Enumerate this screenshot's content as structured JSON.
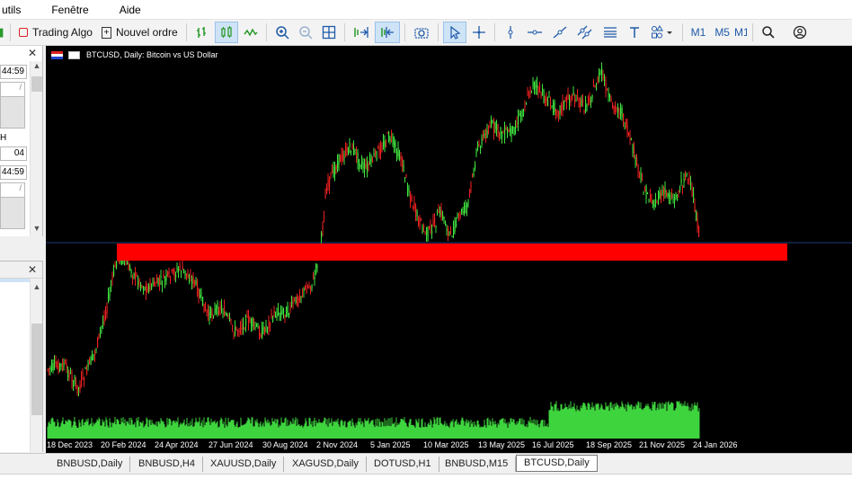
{
  "menu": [
    "utils",
    "Fenêtre",
    "Aide"
  ],
  "toolbar": {
    "trading_algo_label": "Trading Algo",
    "new_order_label": "Nouvel ordre",
    "timeframes": [
      "M1",
      "M5",
      "M1"
    ]
  },
  "left_panel": {
    "time1": "44:59",
    "row_h": "H",
    "row_04": "04",
    "time2": "44:59"
  },
  "chart": {
    "title": "BTCUSD, Daily:  Bitcoin vs US Dollar",
    "background": "#000000",
    "bull_color": "#3fe43f",
    "bear_color": "#e82020",
    "zone_color": "#ff0000",
    "volume_color": "#3ed43e",
    "date_labels": [
      "18 Dec 2023",
      "20 Feb 2024",
      "24 Apr 2024",
      "27 Jun 2024",
      "30 Aug 2024",
      "2 Nov 2024",
      "5 Jan 2025",
      "10 Mar 2025",
      "13 May 2025",
      "16 Jul 2025",
      "18 Sep 2025",
      "21 Nov 2025",
      "24 Jan 2026"
    ]
  },
  "tabs": [
    "BNBUSD,Daily",
    "BNBUSD,H4",
    "XAUUSD,Daily",
    "XAGUSD,Daily",
    "DOTUSD,H1",
    "BNBUSD,M15",
    "BTCUSD,Daily"
  ],
  "active_tab": "BTCUSD,Daily"
}
